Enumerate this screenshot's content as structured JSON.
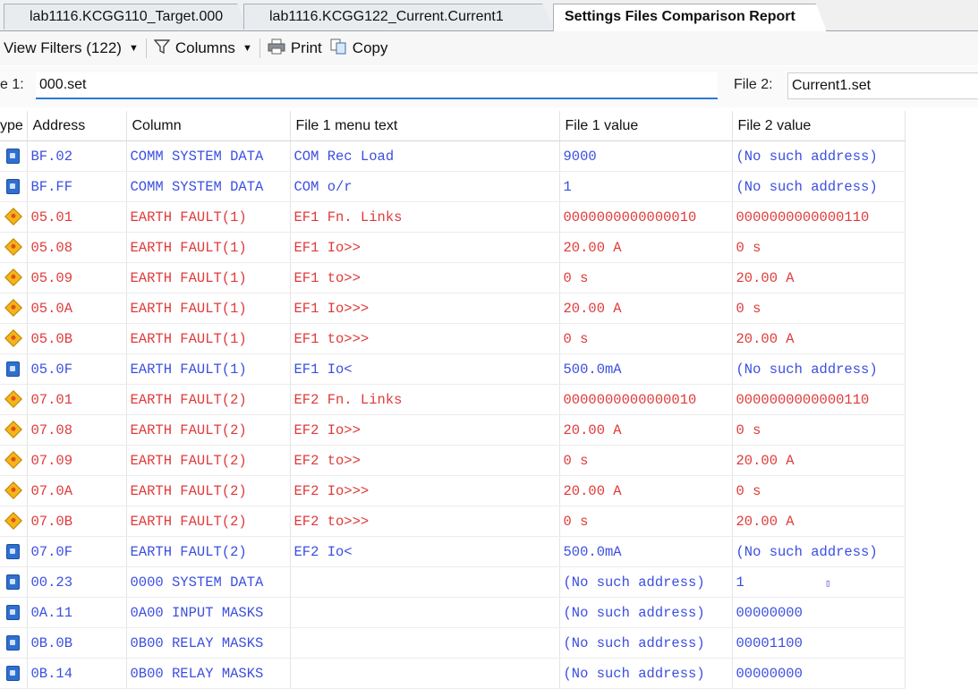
{
  "tabs": [
    {
      "label": "lab1116.KCGG110_Target.000",
      "active": false
    },
    {
      "label": "lab1116.KCGG122_Current.Current1",
      "active": false
    },
    {
      "label": "Settings Files Comparison Report",
      "active": true
    }
  ],
  "toolbar": {
    "view_filters": "View Filters (122)",
    "columns": "Columns",
    "print": "Print",
    "copy": "Copy"
  },
  "files": {
    "file1_label": "e 1:",
    "file1_value": "000.set",
    "file2_label": "File 2:",
    "file2_value": "Current1.set"
  },
  "headers": {
    "type": "ype",
    "address": "Address",
    "column": "Column",
    "menu": "File 1 menu text",
    "v1": "File 1 value",
    "v2": "File 2 value"
  },
  "rows": [
    {
      "icon": "blue",
      "address": "BF.02",
      "column": "COMM SYSTEM DATA",
      "menu": "COM Rec Load",
      "v1": "9000",
      "v2": "(No such address)"
    },
    {
      "icon": "blue",
      "address": "BF.FF",
      "column": "COMM SYSTEM DATA",
      "menu": "COM o/r",
      "v1": "1",
      "v2": "(No such address)"
    },
    {
      "icon": "diamond",
      "address": "05.01",
      "column": "EARTH FAULT(1)",
      "menu": "EF1 Fn. Links",
      "v1": "0000000000000010",
      "v2": "0000000000000110"
    },
    {
      "icon": "diamond",
      "address": "05.08",
      "column": "EARTH FAULT(1)",
      "menu": "EF1 Io>>",
      "v1": "20.00 A",
      "v2": "0 s"
    },
    {
      "icon": "diamond",
      "address": "05.09",
      "column": "EARTH FAULT(1)",
      "menu": "EF1 to>>",
      "v1": "0 s",
      "v2": "20.00 A"
    },
    {
      "icon": "diamond",
      "address": "05.0A",
      "column": "EARTH FAULT(1)",
      "menu": "EF1 Io>>>",
      "v1": "20.00 A",
      "v2": "0 s"
    },
    {
      "icon": "diamond",
      "address": "05.0B",
      "column": "EARTH FAULT(1)",
      "menu": "EF1 to>>>",
      "v1": "0 s",
      "v2": "20.00 A"
    },
    {
      "icon": "blue",
      "address": "05.0F",
      "column": "EARTH FAULT(1)",
      "menu": "EF1 Io<",
      "v1": "500.0mA",
      "v2": "(No such address)"
    },
    {
      "icon": "diamond",
      "address": "07.01",
      "column": "EARTH FAULT(2)",
      "menu": "EF2 Fn. Links",
      "v1": "0000000000000010",
      "v2": "0000000000000110"
    },
    {
      "icon": "diamond",
      "address": "07.08",
      "column": "EARTH FAULT(2)",
      "menu": "EF2 Io>>",
      "v1": "20.00 A",
      "v2": "0 s"
    },
    {
      "icon": "diamond",
      "address": "07.09",
      "column": "EARTH FAULT(2)",
      "menu": "EF2 to>>",
      "v1": "0 s",
      "v2": "20.00 A"
    },
    {
      "icon": "diamond",
      "address": "07.0A",
      "column": "EARTH FAULT(2)",
      "menu": "EF2 Io>>>",
      "v1": "20.00 A",
      "v2": "0 s"
    },
    {
      "icon": "diamond",
      "address": "07.0B",
      "column": "EARTH FAULT(2)",
      "menu": "EF2 to>>>",
      "v1": "0 s",
      "v2": "20.00 A"
    },
    {
      "icon": "blue",
      "address": "07.0F",
      "column": "EARTH FAULT(2)",
      "menu": "EF2 Io<",
      "v1": "500.0mA",
      "v2": "(No such address)"
    },
    {
      "icon": "blue",
      "address": "00.23",
      "column": "0000 SYSTEM DATA",
      "menu": "",
      "v1": "(No such address)",
      "v2": "1"
    },
    {
      "icon": "blue",
      "address": "0A.11",
      "column": "0A00 INPUT MASKS",
      "menu": "",
      "v1": "(No such address)",
      "v2": "00000000"
    },
    {
      "icon": "blue",
      "address": "0B.0B",
      "column": "0B00 RELAY MASKS",
      "menu": "",
      "v1": "(No such address)",
      "v2": "00001100"
    },
    {
      "icon": "blue",
      "address": "0B.14",
      "column": "0B00 RELAY MASKS",
      "menu": "",
      "v1": "(No such address)",
      "v2": "00000000"
    }
  ],
  "colors": {
    "present_row": "#3b4fe0",
    "diff_row": "#e03a3a",
    "selection_accent": "#2d7ad6"
  },
  "icons": {
    "present": "blue-square-icon",
    "diff": "diamond-warning-icon"
  }
}
